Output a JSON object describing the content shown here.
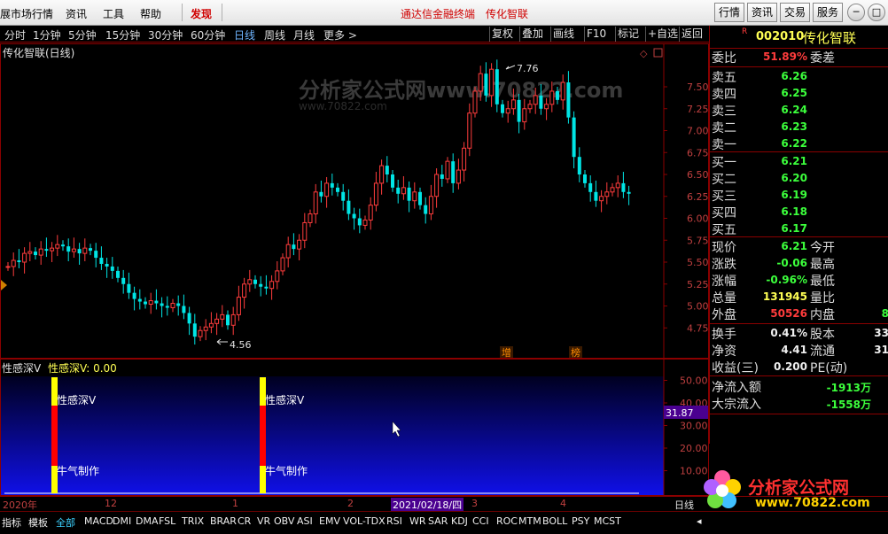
{
  "menubar": {
    "items": [
      "展市场行情",
      "资讯",
      "工具",
      "帮助"
    ],
    "discover": "发现",
    "center_title": "通达信金融终端",
    "center_stock": "传化智联",
    "right_buttons": [
      "行情",
      "资讯",
      "交易",
      "服务"
    ],
    "window_buttons": [
      "─",
      "□"
    ]
  },
  "periods": {
    "items": [
      "分时",
      "1分钟",
      "5分钟",
      "15分钟",
      "30分钟",
      "60分钟",
      "日线",
      "周线",
      "月线",
      "更多 >"
    ],
    "active": "日线",
    "right": [
      "复权",
      "叠加",
      "画线",
      "F10",
      "标记",
      "+自选",
      "返回"
    ]
  },
  "chart": {
    "title": "传化智联(日线)",
    "price_ticks": [
      "7.50",
      "7.25",
      "7.00",
      "6.75",
      "6.50",
      "6.25",
      "6.00",
      "5.75",
      "5.50",
      "5.25",
      "5.00",
      "4.75"
    ],
    "high_label": "7.76",
    "low_label": "4.56",
    "markers": [
      "增",
      "榜"
    ],
    "watermark": "分析家公式网www.70822.com",
    "watermark_sub": "www.70822.com"
  },
  "indicator": {
    "name": "性感深V",
    "value_label": "性感深V: 0.00",
    "ticks": [
      "50.00",
      "40.00",
      "30.00",
      "20.00",
      "10.00"
    ],
    "cursor_value": "31.87",
    "bar_label_top": "性感深V",
    "bar_label_bottom": "牛气制作"
  },
  "dateaxis": {
    "labels": [
      "2020年",
      "12",
      "1",
      "2",
      "3",
      "4"
    ],
    "cursor_date": "2021/02/18/四",
    "right_label": "日线"
  },
  "tabs": {
    "items": [
      "指标",
      "模板",
      "全部",
      "MACD",
      "DMI",
      "DMA",
      "FSL",
      "TRIX",
      "BRAR",
      "CR",
      "VR",
      "OBV",
      "ASI",
      "EMV",
      "VOL-TDX",
      "RSI",
      "WR",
      "SAR",
      "KDJ",
      "CCI",
      "ROC",
      "MTM",
      "BOLL",
      "PSY",
      "MCST"
    ],
    "active": "全部"
  },
  "quote": {
    "badge": "R",
    "code": "002010",
    "name": "传化智联",
    "weibi_label": "委比",
    "weibi": "51.89%",
    "weicha_label": "委差",
    "sell": [
      {
        "l": "卖五",
        "p": "6.26"
      },
      {
        "l": "卖四",
        "p": "6.25"
      },
      {
        "l": "卖三",
        "p": "6.24"
      },
      {
        "l": "卖二",
        "p": "6.23"
      },
      {
        "l": "卖一",
        "p": "6.22"
      }
    ],
    "buy": [
      {
        "l": "买一",
        "p": "6.21"
      },
      {
        "l": "买二",
        "p": "6.20"
      },
      {
        "l": "买三",
        "p": "6.19"
      },
      {
        "l": "买四",
        "p": "6.18"
      },
      {
        "l": "买五",
        "p": "6.17"
      }
    ],
    "stats": [
      {
        "l": "现价",
        "v": "6.21",
        "c": "green",
        "r": "今开"
      },
      {
        "l": "涨跌",
        "v": "-0.06",
        "c": "green",
        "r": "最高"
      },
      {
        "l": "涨幅",
        "v": "-0.96%",
        "c": "green",
        "r": "最低"
      },
      {
        "l": "总量",
        "v": "131945",
        "c": "yel",
        "r": "量比"
      },
      {
        "l": "外盘",
        "v": "50526",
        "c": "red",
        "r": "内盘",
        "rv": "8"
      }
    ],
    "stats2": [
      {
        "l": "换手",
        "v": "0.41%",
        "r": "股本",
        "rv": "33"
      },
      {
        "l": "净资",
        "v": "4.41",
        "r": "流通",
        "rv": "31"
      },
      {
        "l": "收益(三)",
        "v": "0.200",
        "r": "PE(动)",
        "rv": ""
      }
    ],
    "flows": [
      {
        "l": "净流入额",
        "v": "-1913万"
      },
      {
        "l": "大宗流入",
        "v": "-1558万"
      }
    ]
  },
  "site_logo": {
    "text": "分析家公式网",
    "url": "www.70822.com"
  },
  "colors": {
    "up": "#ff3c3c",
    "down": "#00e5e5",
    "axis_red": "#8b0000",
    "indicator_bar_yellow": "#ffff00",
    "indicator_bar_red": "#ff0000"
  }
}
